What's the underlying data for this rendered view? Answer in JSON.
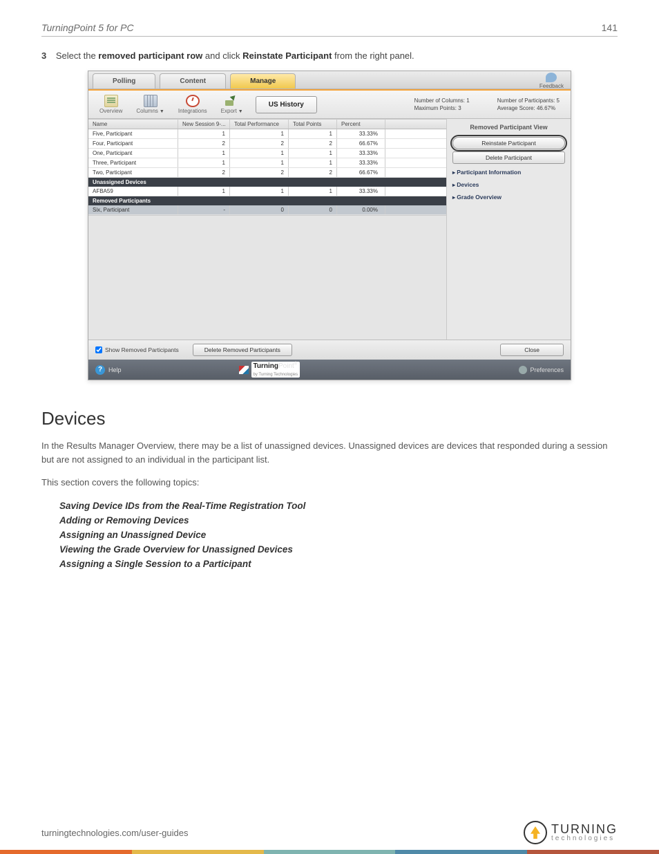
{
  "header": {
    "title": "TurningPoint 5 for PC",
    "page": "141"
  },
  "step": {
    "num": "3",
    "pre": "Select the ",
    "bold1": "removed participant row",
    "mid": " and click ",
    "bold2": "Reinstate Participant",
    "post": " from the right panel."
  },
  "app": {
    "tabs": {
      "polling": "Polling",
      "content": "Content",
      "manage": "Manage"
    },
    "feedback": "Feedback",
    "toolbar": {
      "overview": "Overview",
      "columns": "Columns",
      "integrations": "Integrations",
      "export": "Export",
      "session": "US History"
    },
    "stats": {
      "cols_label": "Number of Columns:",
      "cols_val": "1",
      "max_label": "Maximum Points:",
      "max_val": "3",
      "parts_label": "Number of Participants:",
      "parts_val": "5",
      "avg_label": "Average Score:",
      "avg_val": "46.67%"
    },
    "grid": {
      "headers": {
        "name": "Name",
        "sess": "New Session 9-...",
        "total": "Total Performance",
        "points": "Total Points",
        "percent": "Percent"
      },
      "rows": [
        {
          "name": "Five, Participant",
          "s": "1",
          "t": "1",
          "p": "1",
          "pc": "33.33%"
        },
        {
          "name": "Four, Participant",
          "s": "2",
          "t": "2",
          "p": "2",
          "pc": "66.67%"
        },
        {
          "name": "One, Participant",
          "s": "1",
          "t": "1",
          "p": "1",
          "pc": "33.33%"
        },
        {
          "name": "Three, Participant",
          "s": "1",
          "t": "1",
          "p": "1",
          "pc": "33.33%"
        },
        {
          "name": "Two, Participant",
          "s": "2",
          "t": "2",
          "p": "2",
          "pc": "66.67%"
        }
      ],
      "section_unassigned": "Unassigned Devices",
      "unassigned_rows": [
        {
          "name": "AFBA59",
          "s": "1",
          "t": "1",
          "p": "1",
          "pc": "33.33%"
        }
      ],
      "section_removed": "Removed Participants",
      "removed_rows": [
        {
          "name": "Six, Participant",
          "s": "-",
          "t": "0",
          "p": "0",
          "pc": "0.00%"
        }
      ]
    },
    "right": {
      "title": "Removed Participant View",
      "reinstate": "Reinstate Participant",
      "delete": "Delete Participant",
      "info": "Participant Information",
      "devices": "Devices",
      "grade": "Grade Overview"
    },
    "bottom": {
      "show_removed": "Show Removed Participants",
      "delete_removed": "Delete Removed Participants",
      "close": "Close"
    },
    "status": {
      "help": "Help",
      "prod_bold": "Turning",
      "prod_light": "Point",
      "sub": "by Turning Technologies",
      "prefs": "Preferences"
    }
  },
  "section_heading": "Devices",
  "para1": "In the Results Manager Overview, there may be a list of unassigned devices. Unassigned devices are devices that responded during a session but are not assigned to an individual in the participant list.",
  "para2": "This section covers the following topics:",
  "topics": [
    "Saving Device IDs from the Real-Time Registration Tool",
    "Adding or Removing Devices",
    "Assigning an Unassigned Device",
    "Viewing the Grade Overview for Unassigned Devices",
    "Assigning a Single Session to a Participant"
  ],
  "footer": {
    "url": "turningtechnologies.com/user-guides",
    "logo1": "TURNING",
    "logo2": "technologies"
  }
}
